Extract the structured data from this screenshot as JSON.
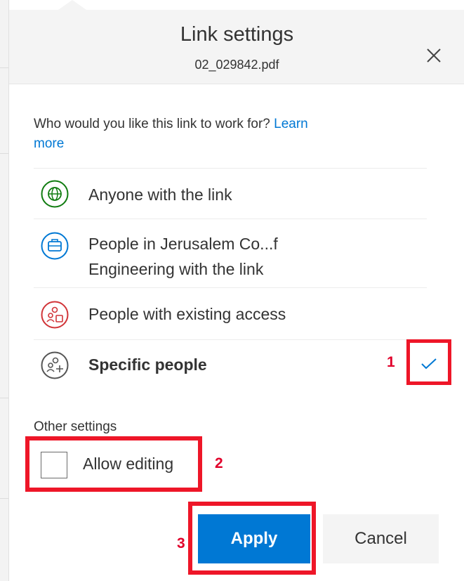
{
  "dialog": {
    "title": "Link settings",
    "filename": "02_029842.pdf"
  },
  "question": {
    "text": "Who would you like this link to work for?",
    "learn_more": "Learn more"
  },
  "options": [
    {
      "icon": "globe-icon",
      "label": "Anyone with the link",
      "color": "#107c10"
    },
    {
      "icon": "briefcase-icon",
      "label_line1": "People in Jerusalem Co...f",
      "label_line2": "Engineering with the link",
      "color": "#0078d4"
    },
    {
      "icon": "people-group-icon",
      "label": "People with existing access",
      "color": "#d13438"
    },
    {
      "icon": "people-add-icon",
      "label": "Specific people",
      "color": "#555555",
      "selected": true
    }
  ],
  "annotations": {
    "a1": "1",
    "a2": "2",
    "a3": "3"
  },
  "other_settings": {
    "heading": "Other settings",
    "allow_editing_label": "Allow editing",
    "allow_editing_checked": false
  },
  "buttons": {
    "apply": "Apply",
    "cancel": "Cancel"
  },
  "colors": {
    "accent": "#0078d4",
    "highlight": "#ee1628",
    "annotation": "#e1002a"
  }
}
